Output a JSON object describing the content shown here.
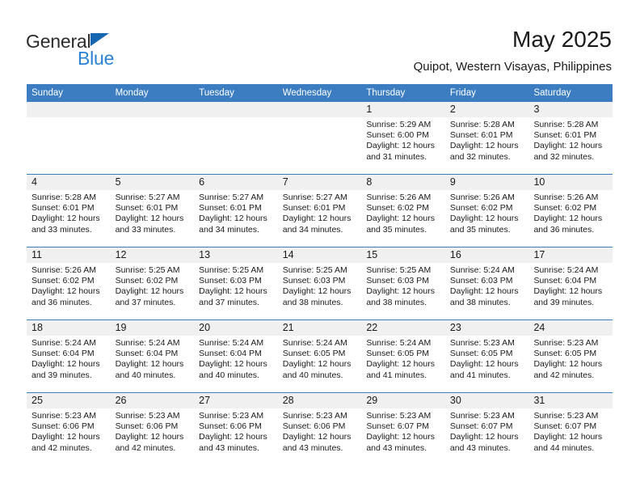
{
  "brand": {
    "name_part1": "General",
    "name_part2": "Blue",
    "triangle_color": "#1565b0",
    "blue_text_color": "#2a82d6"
  },
  "header": {
    "title": "May 2025",
    "subtitle": "Quipot, Western Visayas, Philippines",
    "accent_color": "#3b7dc0",
    "number_band_color": "#f0f0f0"
  },
  "calendar": {
    "weekday_headers": [
      "Sunday",
      "Monday",
      "Tuesday",
      "Wednesday",
      "Thursday",
      "Friday",
      "Saturday"
    ],
    "weeks": [
      {
        "days": [
          {
            "number": "",
            "lines": []
          },
          {
            "number": "",
            "lines": []
          },
          {
            "number": "",
            "lines": []
          },
          {
            "number": "",
            "lines": []
          },
          {
            "number": "1",
            "lines": [
              "Sunrise: 5:29 AM",
              "Sunset: 6:00 PM",
              "Daylight: 12 hours",
              "and 31 minutes."
            ]
          },
          {
            "number": "2",
            "lines": [
              "Sunrise: 5:28 AM",
              "Sunset: 6:01 PM",
              "Daylight: 12 hours",
              "and 32 minutes."
            ]
          },
          {
            "number": "3",
            "lines": [
              "Sunrise: 5:28 AM",
              "Sunset: 6:01 PM",
              "Daylight: 12 hours",
              "and 32 minutes."
            ]
          }
        ]
      },
      {
        "days": [
          {
            "number": "4",
            "lines": [
              "Sunrise: 5:28 AM",
              "Sunset: 6:01 PM",
              "Daylight: 12 hours",
              "and 33 minutes."
            ]
          },
          {
            "number": "5",
            "lines": [
              "Sunrise: 5:27 AM",
              "Sunset: 6:01 PM",
              "Daylight: 12 hours",
              "and 33 minutes."
            ]
          },
          {
            "number": "6",
            "lines": [
              "Sunrise: 5:27 AM",
              "Sunset: 6:01 PM",
              "Daylight: 12 hours",
              "and 34 minutes."
            ]
          },
          {
            "number": "7",
            "lines": [
              "Sunrise: 5:27 AM",
              "Sunset: 6:01 PM",
              "Daylight: 12 hours",
              "and 34 minutes."
            ]
          },
          {
            "number": "8",
            "lines": [
              "Sunrise: 5:26 AM",
              "Sunset: 6:02 PM",
              "Daylight: 12 hours",
              "and 35 minutes."
            ]
          },
          {
            "number": "9",
            "lines": [
              "Sunrise: 5:26 AM",
              "Sunset: 6:02 PM",
              "Daylight: 12 hours",
              "and 35 minutes."
            ]
          },
          {
            "number": "10",
            "lines": [
              "Sunrise: 5:26 AM",
              "Sunset: 6:02 PM",
              "Daylight: 12 hours",
              "and 36 minutes."
            ]
          }
        ]
      },
      {
        "days": [
          {
            "number": "11",
            "lines": [
              "Sunrise: 5:26 AM",
              "Sunset: 6:02 PM",
              "Daylight: 12 hours",
              "and 36 minutes."
            ]
          },
          {
            "number": "12",
            "lines": [
              "Sunrise: 5:25 AM",
              "Sunset: 6:02 PM",
              "Daylight: 12 hours",
              "and 37 minutes."
            ]
          },
          {
            "number": "13",
            "lines": [
              "Sunrise: 5:25 AM",
              "Sunset: 6:03 PM",
              "Daylight: 12 hours",
              "and 37 minutes."
            ]
          },
          {
            "number": "14",
            "lines": [
              "Sunrise: 5:25 AM",
              "Sunset: 6:03 PM",
              "Daylight: 12 hours",
              "and 38 minutes."
            ]
          },
          {
            "number": "15",
            "lines": [
              "Sunrise: 5:25 AM",
              "Sunset: 6:03 PM",
              "Daylight: 12 hours",
              "and 38 minutes."
            ]
          },
          {
            "number": "16",
            "lines": [
              "Sunrise: 5:24 AM",
              "Sunset: 6:03 PM",
              "Daylight: 12 hours",
              "and 38 minutes."
            ]
          },
          {
            "number": "17",
            "lines": [
              "Sunrise: 5:24 AM",
              "Sunset: 6:04 PM",
              "Daylight: 12 hours",
              "and 39 minutes."
            ]
          }
        ]
      },
      {
        "days": [
          {
            "number": "18",
            "lines": [
              "Sunrise: 5:24 AM",
              "Sunset: 6:04 PM",
              "Daylight: 12 hours",
              "and 39 minutes."
            ]
          },
          {
            "number": "19",
            "lines": [
              "Sunrise: 5:24 AM",
              "Sunset: 6:04 PM",
              "Daylight: 12 hours",
              "and 40 minutes."
            ]
          },
          {
            "number": "20",
            "lines": [
              "Sunrise: 5:24 AM",
              "Sunset: 6:04 PM",
              "Daylight: 12 hours",
              "and 40 minutes."
            ]
          },
          {
            "number": "21",
            "lines": [
              "Sunrise: 5:24 AM",
              "Sunset: 6:05 PM",
              "Daylight: 12 hours",
              "and 40 minutes."
            ]
          },
          {
            "number": "22",
            "lines": [
              "Sunrise: 5:24 AM",
              "Sunset: 6:05 PM",
              "Daylight: 12 hours",
              "and 41 minutes."
            ]
          },
          {
            "number": "23",
            "lines": [
              "Sunrise: 5:23 AM",
              "Sunset: 6:05 PM",
              "Daylight: 12 hours",
              "and 41 minutes."
            ]
          },
          {
            "number": "24",
            "lines": [
              "Sunrise: 5:23 AM",
              "Sunset: 6:05 PM",
              "Daylight: 12 hours",
              "and 42 minutes."
            ]
          }
        ]
      },
      {
        "days": [
          {
            "number": "25",
            "lines": [
              "Sunrise: 5:23 AM",
              "Sunset: 6:06 PM",
              "Daylight: 12 hours",
              "and 42 minutes."
            ]
          },
          {
            "number": "26",
            "lines": [
              "Sunrise: 5:23 AM",
              "Sunset: 6:06 PM",
              "Daylight: 12 hours",
              "and 42 minutes."
            ]
          },
          {
            "number": "27",
            "lines": [
              "Sunrise: 5:23 AM",
              "Sunset: 6:06 PM",
              "Daylight: 12 hours",
              "and 43 minutes."
            ]
          },
          {
            "number": "28",
            "lines": [
              "Sunrise: 5:23 AM",
              "Sunset: 6:06 PM",
              "Daylight: 12 hours",
              "and 43 minutes."
            ]
          },
          {
            "number": "29",
            "lines": [
              "Sunrise: 5:23 AM",
              "Sunset: 6:07 PM",
              "Daylight: 12 hours",
              "and 43 minutes."
            ]
          },
          {
            "number": "30",
            "lines": [
              "Sunrise: 5:23 AM",
              "Sunset: 6:07 PM",
              "Daylight: 12 hours",
              "and 43 minutes."
            ]
          },
          {
            "number": "31",
            "lines": [
              "Sunrise: 5:23 AM",
              "Sunset: 6:07 PM",
              "Daylight: 12 hours",
              "and 44 minutes."
            ]
          }
        ]
      }
    ]
  }
}
